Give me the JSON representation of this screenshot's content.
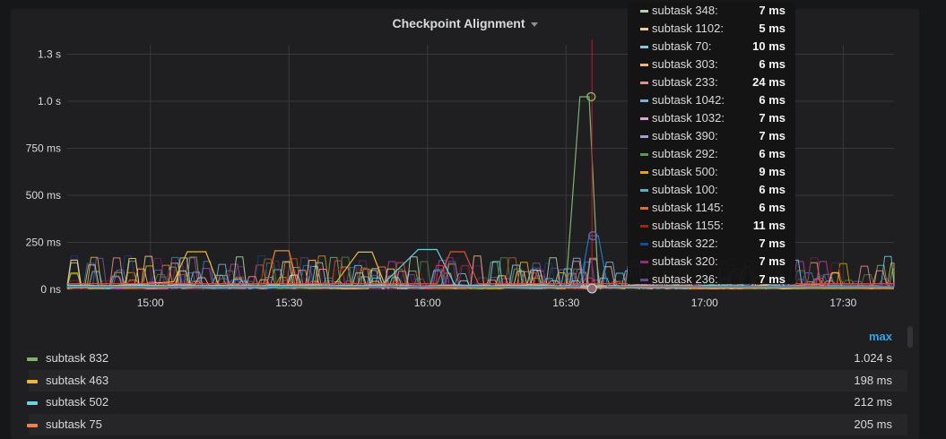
{
  "panel": {
    "title": "Checkpoint Alignment"
  },
  "chart_data": {
    "type": "line",
    "title": "Checkpoint Alignment",
    "xlabel": "",
    "ylabel": "",
    "y_ticks": [
      "1.3 s",
      "1.0 s",
      "750 ms",
      "500 ms",
      "250 ms",
      "0 ns"
    ],
    "y_tick_values_ms": [
      1250,
      1000,
      750,
      500,
      250,
      0
    ],
    "x_ticks": [
      "15:00",
      "15:30",
      "16:00",
      "16:30",
      "17:00",
      "17:30"
    ],
    "x_tick_minutes": [
      900,
      930,
      960,
      990,
      1020,
      1050
    ],
    "x_range_minutes": [
      882,
      1061
    ],
    "ylim_ms": [
      0,
      1300
    ],
    "grid": true,
    "hover_time_minutes": 996,
    "colors": [
      "#7eb26d",
      "#eab839",
      "#6ed0e0",
      "#ef843c",
      "#e24d42",
      "#1f78c1",
      "#ba43a9",
      "#705da0",
      "#508642",
      "#cca300",
      "#447ebc",
      "#c15c17",
      "#890f02",
      "#0a437c",
      "#6d1f62",
      "#584477",
      "#b7dbab",
      "#f4d598",
      "#70dbed",
      "#f9ba8f",
      "#f29191",
      "#82b5d8",
      "#e5a8e2",
      "#aea2e0"
    ],
    "series": [
      {
        "values": [
          [
            882,
            10
          ],
          [
            900,
            12
          ],
          [
            930,
            8
          ],
          [
            960,
            15
          ],
          [
            990,
            20
          ],
          [
            993,
            1024
          ],
          [
            995,
            1024
          ],
          [
            997,
            10
          ],
          [
            1020,
            12
          ],
          [
            1061,
            8
          ]
        ]
      },
      {
        "values": [
          [
            882,
            5
          ],
          [
            905,
            40
          ],
          [
            908,
            200
          ],
          [
            912,
            200
          ],
          [
            915,
            8
          ],
          [
            940,
            30
          ],
          [
            945,
            198
          ],
          [
            948,
            198
          ],
          [
            951,
            10
          ],
          [
            1061,
            5
          ]
        ]
      },
      {
        "values": [
          [
            882,
            20
          ],
          [
            950,
            20
          ],
          [
            958,
            212
          ],
          [
            962,
            212
          ],
          [
            966,
            20
          ],
          [
            1061,
            15
          ]
        ]
      },
      {
        "values": [
          [
            882,
            8
          ],
          [
            925,
            10
          ],
          [
            927,
            205
          ],
          [
            930,
            205
          ],
          [
            932,
            10
          ],
          [
            1061,
            8
          ]
        ]
      },
      {
        "values": [
          [
            882,
            30
          ],
          [
            962,
            30
          ],
          [
            965,
            200
          ],
          [
            968,
            200
          ],
          [
            971,
            30
          ],
          [
            1061,
            30
          ]
        ]
      },
      {
        "values": [
          [
            882,
            15
          ],
          [
            993,
            15
          ],
          [
            995,
            285
          ],
          [
            997,
            285
          ],
          [
            999,
            15
          ],
          [
            1061,
            15
          ]
        ]
      }
    ]
  },
  "tooltip": {
    "rows": [
      {
        "name": "subtask 348:",
        "value": "7 ms",
        "color": "#b7dbab"
      },
      {
        "name": "subtask 1102:",
        "value": "5 ms",
        "color": "#f4d598"
      },
      {
        "name": "subtask 70:",
        "value": "10 ms",
        "color": "#70dbed"
      },
      {
        "name": "subtask 303:",
        "value": "6 ms",
        "color": "#f9ba8f"
      },
      {
        "name": "subtask 233:",
        "value": "24 ms",
        "color": "#f29191"
      },
      {
        "name": "subtask 1042:",
        "value": "6 ms",
        "color": "#82b5d8"
      },
      {
        "name": "subtask 1032:",
        "value": "7 ms",
        "color": "#e5a8e2"
      },
      {
        "name": "subtask 390:",
        "value": "7 ms",
        "color": "#aea2e0"
      },
      {
        "name": "subtask 292:",
        "value": "6 ms",
        "color": "#629e51"
      },
      {
        "name": "subtask 500:",
        "value": "9 ms",
        "color": "#e5ac0e"
      },
      {
        "name": "subtask 100:",
        "value": "6 ms",
        "color": "#64b0c8"
      },
      {
        "name": "subtask 1145:",
        "value": "6 ms",
        "color": "#e0752d"
      },
      {
        "name": "subtask 1155:",
        "value": "11 ms",
        "color": "#bf1b00"
      },
      {
        "name": "subtask 322:",
        "value": "7 ms",
        "color": "#0a50a1"
      },
      {
        "name": "subtask 320:",
        "value": "7 ms",
        "color": "#962d82"
      },
      {
        "name": "subtask 236:",
        "value": "7 ms",
        "color": "#614d93"
      }
    ]
  },
  "legend": {
    "max_header": "max",
    "rows": [
      {
        "name": "subtask 832",
        "max": "1.024 s",
        "color": "#7eb26d"
      },
      {
        "name": "subtask 463",
        "max": "198 ms",
        "color": "#eab839"
      },
      {
        "name": "subtask 502",
        "max": "212 ms",
        "color": "#6ed0e0"
      },
      {
        "name": "subtask 75",
        "max": "205 ms",
        "color": "#ef843c"
      }
    ]
  }
}
